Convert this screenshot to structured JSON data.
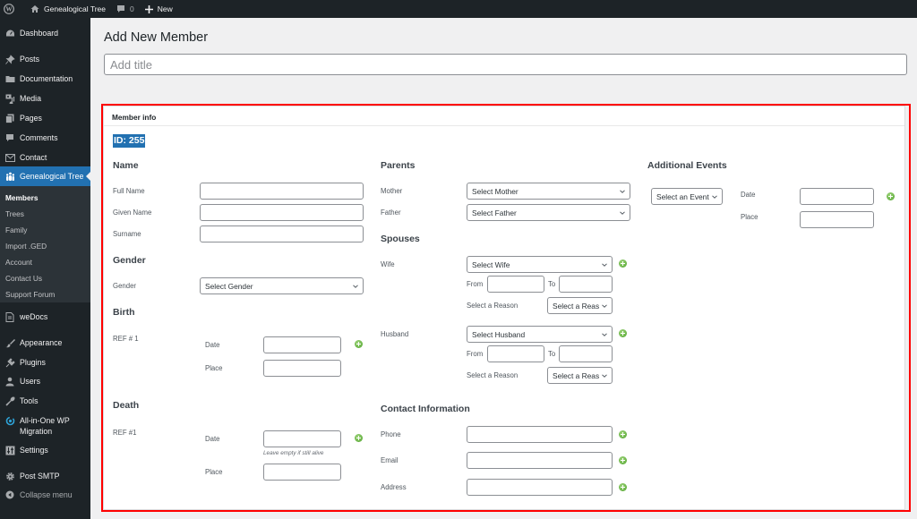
{
  "admin_bar": {
    "site_name": "Genealogical Tree",
    "comments_count": "0",
    "new_label": "New"
  },
  "sidebar": {
    "items": [
      {
        "label": "Dashboard",
        "icon": "dashboard-icon"
      },
      {
        "label": "Posts",
        "icon": "pin-icon"
      },
      {
        "label": "Documentation",
        "icon": "folder-icon"
      },
      {
        "label": "Media",
        "icon": "media-icon"
      },
      {
        "label": "Pages",
        "icon": "pages-icon"
      },
      {
        "label": "Comments",
        "icon": "comment-icon"
      },
      {
        "label": "Contact",
        "icon": "envelope-icon"
      },
      {
        "label": "Genealogical Tree",
        "icon": "family-icon",
        "current": true
      },
      {
        "label": "weDocs",
        "icon": "document-icon"
      },
      {
        "label": "Appearance",
        "icon": "paintbrush-icon"
      },
      {
        "label": "Plugins",
        "icon": "plug-icon"
      },
      {
        "label": "Users",
        "icon": "user-icon"
      },
      {
        "label": "Tools",
        "icon": "wrench-icon"
      },
      {
        "label": "All-in-One WP",
        "label2": "Migration",
        "icon": "migration-icon"
      },
      {
        "label": "Settings",
        "icon": "sliders-icon"
      },
      {
        "label": "Post SMTP",
        "icon": "gear-icon"
      },
      {
        "label": "Collapse menu",
        "icon": "collapse-icon"
      }
    ],
    "submenu": [
      "Members",
      "Trees",
      "Family",
      "Import .GED",
      "Account",
      "Contact Us",
      "Support Forum"
    ]
  },
  "page": {
    "title": "Add New Member",
    "title_placeholder": "Add title"
  },
  "panel": {
    "heading": "Member info",
    "id_label": "ID: 255",
    "name": {
      "heading": "Name",
      "full_name": "Full Name",
      "given_name": "Given Name",
      "surname": "Surname"
    },
    "gender": {
      "heading": "Gender",
      "label": "Gender",
      "select": "Select Gender"
    },
    "birth": {
      "heading": "Birth",
      "ref": "REF # 1",
      "date": "Date",
      "place": "Place"
    },
    "death": {
      "heading": "Death",
      "ref": "REF #1",
      "date": "Date",
      "place": "Place",
      "hint": "Leave empty if still alive"
    },
    "parents": {
      "heading": "Parents",
      "mother": "Mother",
      "mother_select": "Select Mother",
      "father": "Father",
      "father_select": "Select Father"
    },
    "spouses": {
      "heading": "Spouses",
      "wife": "Wife",
      "wife_select": "Select Wife",
      "husband": "Husband",
      "husband_select": "Select Husband",
      "from": "From",
      "to": "To",
      "reason_label": "Select a Reason",
      "reason_select": "Select a Reas"
    },
    "contact": {
      "heading": "Contact Information",
      "phone": "Phone",
      "email": "Email",
      "address": "Address"
    },
    "events": {
      "heading": "Additional Events",
      "select": "Select an Event",
      "date": "Date",
      "place": "Place"
    }
  },
  "colors": {
    "accent": "#2271b1",
    "admin_dark": "#1d2327",
    "highlight": "#ff0000",
    "add_green": "#4ea32c"
  }
}
